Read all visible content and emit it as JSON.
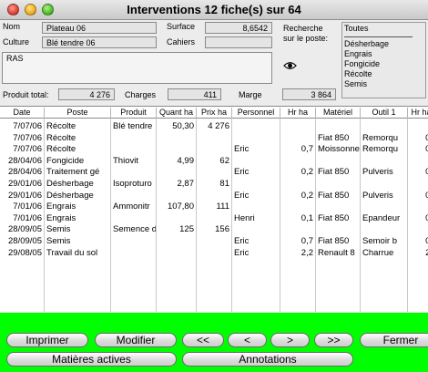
{
  "window": {
    "title": "Interventions 12 fiche(s) sur 64"
  },
  "form": {
    "nom_label": "Nom",
    "nom_value": "Plateau 06",
    "culture_label": "Culture",
    "culture_value": "Blé tendre 06",
    "surface_label": "Surface",
    "surface_value": "8,6542",
    "cahiers_label": "Cahiers",
    "cahiers_value": "",
    "recherche_label_1": "Recherche",
    "recherche_label_2": "sur le poste:",
    "notes_value": "RAS",
    "eye_icon": "eye-icon"
  },
  "poste_list": {
    "selected": "Toutes",
    "items": [
      "Désherbage",
      "Engrais",
      "Fongicide",
      "Récolte",
      "Semis"
    ]
  },
  "totals": {
    "produit_label": "Produit total:",
    "produit_value": "4 276",
    "charges_label": "Charges",
    "charges_value": "411",
    "marge_label": "Marge",
    "marge_value": "3 864"
  },
  "table": {
    "headers": [
      "Date",
      "Poste",
      "Produit",
      "Quant ha",
      "Prix ha",
      "Personnel",
      "Hr ha",
      "Matériel",
      "Outil 1",
      "Hr ha"
    ],
    "rows": [
      [
        "7/07/06",
        "Récolte",
        "Blé tendre",
        "50,30",
        "4 276",
        "",
        "",
        "",
        "",
        ""
      ],
      [
        "7/07/06",
        "Récolte",
        "",
        "",
        "",
        "",
        "",
        "Fiat 850",
        "Remorqu",
        "0,"
      ],
      [
        "7/07/06",
        "Récolte",
        "",
        "",
        "",
        "Eric",
        "0,7",
        "Moissonne",
        "Remorqu",
        "0,"
      ],
      [
        "28/04/06",
        "Fongicide",
        "Thiovit",
        "4,99",
        "62",
        "",
        "",
        "",
        "",
        ""
      ],
      [
        "28/04/06",
        "Traitement gé",
        "",
        "",
        "",
        "Eric",
        "0,2",
        "Fiat 850",
        "Pulveris",
        "0,"
      ],
      [
        "29/01/06",
        "Désherbage",
        "Isoproturo",
        "2,87",
        "81",
        "",
        "",
        "",
        "",
        ""
      ],
      [
        "29/01/06",
        "Désherbage",
        "",
        "",
        "",
        "Eric",
        "0,2",
        "Fiat 850",
        "Pulveris",
        "0,"
      ],
      [
        "7/01/06",
        "Engrais",
        "Ammonitr",
        "107,80",
        "111",
        "",
        "",
        "",
        "",
        ""
      ],
      [
        "7/01/06",
        "Engrais",
        "",
        "",
        "",
        "Henri",
        "0,1",
        "Fiat 850",
        "Epandeur",
        "0,"
      ],
      [
        "28/09/05",
        "Semis",
        "Semence d",
        "125",
        "156",
        "",
        "",
        "",
        "",
        ""
      ],
      [
        "28/09/05",
        "Semis",
        "",
        "",
        "",
        "Eric",
        "0,7",
        "Fiat 850",
        "Semoir b",
        "0,"
      ],
      [
        "29/08/05",
        "Travail du sol",
        "",
        "",
        "",
        "Eric",
        "2,2",
        "Renault 8",
        "Charrue",
        "2,"
      ]
    ]
  },
  "buttons": {
    "imprimer": "Imprimer",
    "modifier": "Modifier",
    "first": "<<",
    "prev": "<",
    "next": ">",
    "last": ">>",
    "fermer": "Fermer",
    "matieres": "Matières actives",
    "annotations": "Annotations"
  },
  "colors": {
    "panel_green": "#00ff00",
    "close": "#e0443a",
    "minimize": "#f0b020",
    "maximize": "#4cbf2b"
  }
}
